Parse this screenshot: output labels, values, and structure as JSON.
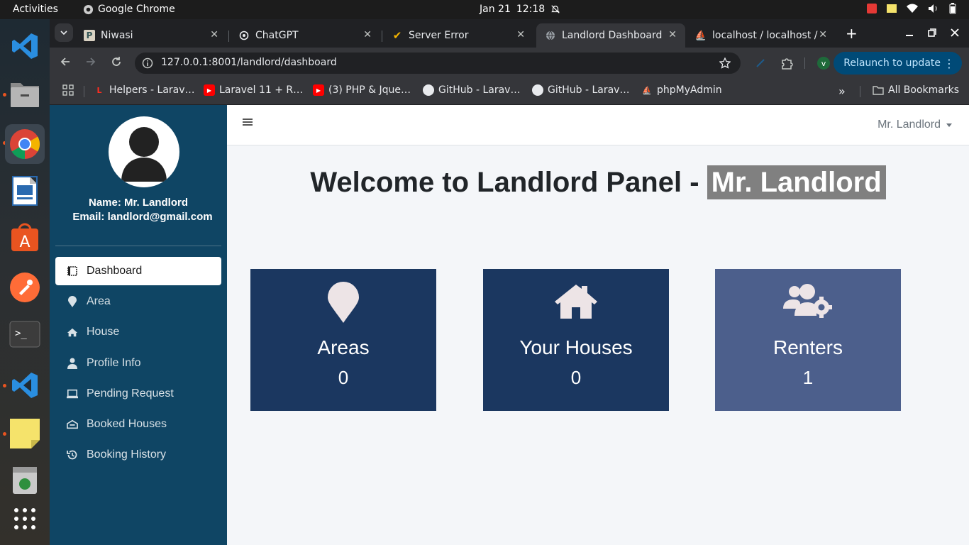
{
  "topbar": {
    "activities": "Activities",
    "app_name": "Google Chrome",
    "date": "Jan 21",
    "time": "12:18"
  },
  "dock": {
    "items": [
      "vscode-icon",
      "files-icon",
      "chrome-icon",
      "libreoffice-impress-icon",
      "app-center-icon",
      "postman-icon",
      "terminal-icon",
      "vscode-icon",
      "sticky-notes-icon",
      "trash-icon",
      "app-grid-icon"
    ]
  },
  "tabs": [
    {
      "title": "Niwasi",
      "active": false
    },
    {
      "title": "ChatGPT",
      "active": false
    },
    {
      "title": "Server Error",
      "active": false
    },
    {
      "title": "Landlord Dashboard",
      "active": true
    },
    {
      "title": "localhost / localhost /",
      "active": false
    }
  ],
  "toolbar": {
    "url": "127.0.0.1:8001/landlord/dashboard",
    "profile_initial": "v",
    "relaunch_label": "Relaunch to update"
  },
  "bookmarks": {
    "items": [
      {
        "label": "Helpers - Larav…",
        "icon": "laravel-icon"
      },
      {
        "label": "Laravel 11 + R…",
        "icon": "youtube-icon"
      },
      {
        "label": "(3) PHP & Jque…",
        "icon": "youtube-icon"
      },
      {
        "label": "GitHub - Larav…",
        "icon": "github-icon"
      },
      {
        "label": "GitHub - Larav…",
        "icon": "github-icon"
      },
      {
        "label": "phpMyAdmin",
        "icon": "phpmyadmin-icon"
      }
    ],
    "all_bookmarks": "All Bookmarks"
  },
  "sidebar": {
    "name_line": "Name: Mr. Landlord",
    "email_line": "Email: landlord@gmail.com",
    "items": [
      {
        "label": "Dashboard",
        "icon": "dashboard-icon",
        "active": true
      },
      {
        "label": "Area",
        "icon": "map-marker-icon"
      },
      {
        "label": "House",
        "icon": "home-icon"
      },
      {
        "label": "Profile Info",
        "icon": "user-icon"
      },
      {
        "label": "Pending Request",
        "icon": "laptop-icon"
      },
      {
        "label": "Booked Houses",
        "icon": "booked-house-icon"
      },
      {
        "label": "Booking History",
        "icon": "history-icon"
      }
    ]
  },
  "navbar": {
    "user_menu": "Mr. Landlord"
  },
  "main": {
    "welcome_prefix": "Welcome to Landlord Panel -",
    "welcome_name": "Mr. Landlord",
    "cards": [
      {
        "title": "Areas",
        "value": "0",
        "icon": "map-marker-icon",
        "color": "#1b3760"
      },
      {
        "title": "Your Houses",
        "value": "0",
        "icon": "home-icon",
        "color": "#1b3760"
      },
      {
        "title": "Renters",
        "value": "1",
        "icon": "users-cog-icon",
        "color": "#4c5f8c"
      }
    ]
  },
  "colors": {
    "sidebar_bg": "#0f4564",
    "page_bg": "#f4f6f9",
    "card_dark": "#1b3760",
    "card_light": "#4c5f8c",
    "highlight": "#808080"
  }
}
